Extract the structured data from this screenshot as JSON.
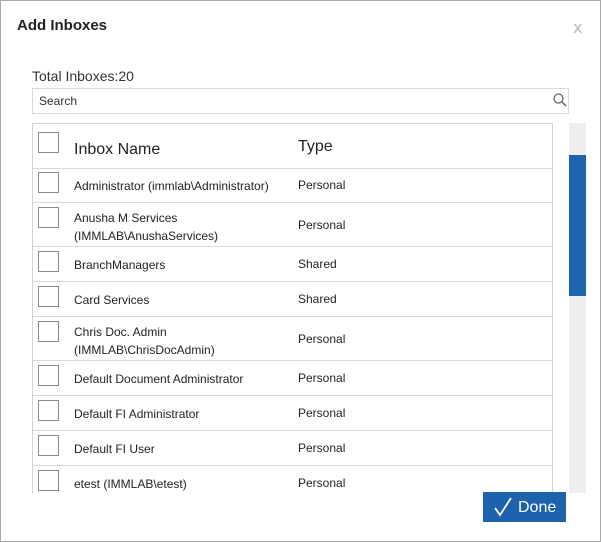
{
  "dialog": {
    "title": "Add Inboxes",
    "close_label": "x",
    "total_label": "Total Inboxes:20"
  },
  "search": {
    "placeholder": "Search",
    "icon": "search-icon"
  },
  "table": {
    "columns": {
      "name": "Inbox Name",
      "type": "Type"
    },
    "rows": [
      {
        "name": "Administrator (immlab\\Administrator)",
        "type": "Personal"
      },
      {
        "name": "Anusha M Services\n(IMMLAB\\AnushaServices)",
        "type": "Personal"
      },
      {
        "name": "BranchManagers",
        "type": "Shared"
      },
      {
        "name": "Card Services",
        "type": "Shared"
      },
      {
        "name": "Chris Doc. Admin\n(IMMLAB\\ChrisDocAdmin)",
        "type": "Personal"
      },
      {
        "name": "Default Document Administrator",
        "type": "Personal"
      },
      {
        "name": "Default FI Administrator",
        "type": "Personal"
      },
      {
        "name": "Default FI User",
        "type": "Personal"
      },
      {
        "name": "etest (IMMLAB\\etest)",
        "type": "Personal"
      }
    ]
  },
  "footer": {
    "done_label": "Done",
    "done_icon": "checkmark-icon"
  },
  "colors": {
    "accent": "#1d62ac",
    "scroll_thumb": "#1e63ad"
  }
}
